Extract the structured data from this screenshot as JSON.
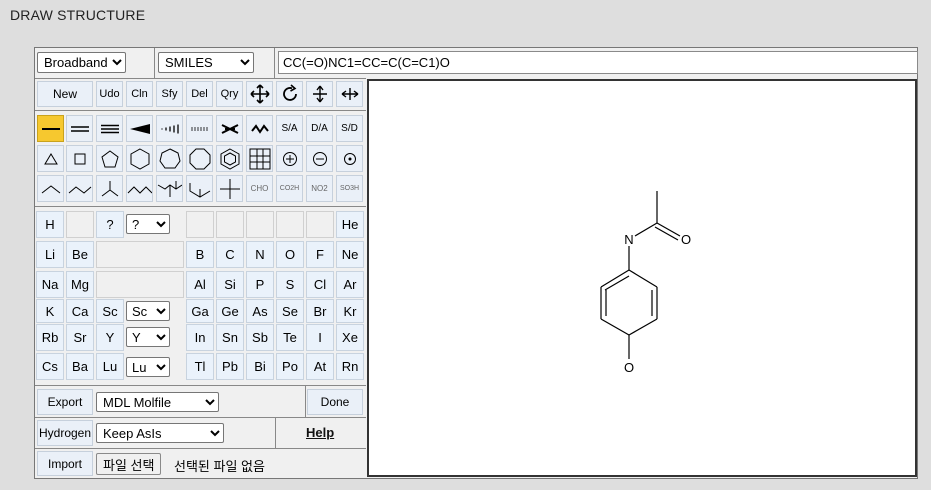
{
  "page_title": "DRAW STRUCTURE",
  "top_bar": {
    "search_type": "Broadband",
    "format": "SMILES",
    "smiles_value": "CC(=O)NC1=CC=C(C=C1)O"
  },
  "command_buttons": [
    "New",
    "Udo",
    "Cln",
    "Sfy",
    "Del",
    "Qry"
  ],
  "command_icon_names": [
    "move-icon",
    "rotate-icon",
    "flip-vertical-icon",
    "flip-horizontal-icon"
  ],
  "bond_buttons": [
    "single-bond-icon",
    "double-bond-icon",
    "triple-bond-icon",
    "wedge-bond-icon",
    "hash-bond-icon",
    "wavy-hash-bond-icon",
    "cut-bond-icon",
    "stereo-bond-icon"
  ],
  "stereo_labels": [
    "S/A",
    "D/A",
    "S/D"
  ],
  "ring_buttons": [
    "triangle-ring-icon",
    "square-ring-icon",
    "pentagon-ring-icon",
    "hexagon-ring-icon",
    "heptagon-ring-icon",
    "octagon-ring-icon",
    "benzene-ring-icon",
    "grid-icon",
    "plus-charge-icon",
    "minus-charge-icon",
    "radical-icon"
  ],
  "chain_buttons": [
    "chain-2-icon",
    "chain-3-icon",
    "branch-3-icon",
    "chain-4-icon",
    "branch-4-icon",
    "branch-5-icon",
    "cross-icon"
  ],
  "group_labels": {
    "cho": "CHO",
    "co2h": "CO2H",
    "no2": "NO2",
    "so3h": "SO3H"
  },
  "periodic_table": {
    "row1": {
      "h": "H",
      "q": "?",
      "q_select": "?",
      "he": "He"
    },
    "row2": [
      "Li",
      "Be",
      "B",
      "C",
      "N",
      "O",
      "F",
      "Ne"
    ],
    "row3": [
      "Na",
      "Mg",
      "Al",
      "Si",
      "P",
      "S",
      "Cl",
      "Ar"
    ],
    "row4": [
      "K",
      "Ca",
      "Sc",
      "Ga",
      "Ge",
      "As",
      "Se",
      "Br",
      "Kr"
    ],
    "row4_select": "Sc",
    "row5": [
      "Rb",
      "Sr",
      "Y",
      "In",
      "Sn",
      "Sb",
      "Te",
      "I",
      "Xe"
    ],
    "row5_select": "Y",
    "row6": [
      "Cs",
      "Ba",
      "Lu",
      "Tl",
      "Pb",
      "Bi",
      "Po",
      "At",
      "Rn"
    ],
    "row6_select": "Lu"
  },
  "bottom": {
    "export_label": "Export",
    "export_format": "MDL Molfile",
    "done_label": "Done",
    "hydrogen_label": "Hydrogen",
    "hydrogen_mode": "Keep AsIs",
    "help_label": "Help",
    "import_label": "Import",
    "file_button": "파일 선택",
    "file_status": "선택된 파일 없음"
  },
  "molecule": {
    "atom_labels": {
      "n": "N",
      "o_carbonyl": "O",
      "o_hydroxyl": "O"
    }
  }
}
